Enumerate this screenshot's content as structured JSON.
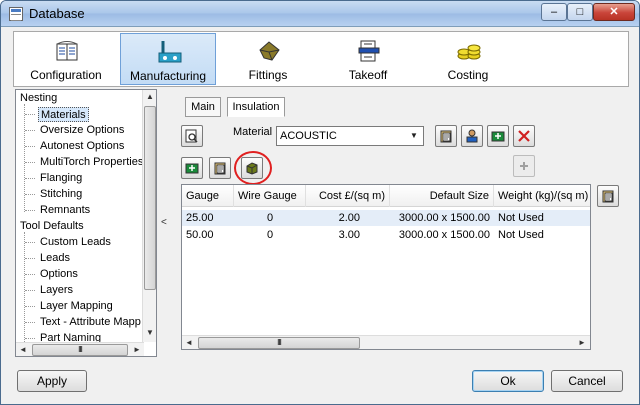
{
  "window": {
    "title": "Database",
    "minimize": "–",
    "maximize": "□",
    "close": "✕"
  },
  "toolbar": [
    {
      "id": "configuration",
      "label": "Configuration",
      "icon": "books-icon"
    },
    {
      "id": "manufacturing",
      "label": "Manufacturing",
      "icon": "manufacturing-icon",
      "active": true
    },
    {
      "id": "fittings",
      "label": "Fittings",
      "icon": "fitting-icon"
    },
    {
      "id": "takeoff",
      "label": "Takeoff",
      "icon": "takeoff-icon"
    },
    {
      "id": "costing",
      "label": "Costing",
      "icon": "coins-icon"
    }
  ],
  "tree": {
    "items": [
      {
        "label": "Nesting",
        "level": 0
      },
      {
        "label": "Materials",
        "level": 1,
        "selected": true
      },
      {
        "label": "Oversize Options",
        "level": 1
      },
      {
        "label": "Autonest Options",
        "level": 1
      },
      {
        "label": "MultiTorch Properties",
        "level": 1
      },
      {
        "label": "Flanging",
        "level": 1
      },
      {
        "label": "Stitching",
        "level": 1
      },
      {
        "label": "Remnants",
        "level": 1
      },
      {
        "label": "Tool Defaults",
        "level": 0
      },
      {
        "label": "Custom Leads",
        "level": 1
      },
      {
        "label": "Leads",
        "level": 1
      },
      {
        "label": "Options",
        "level": 1
      },
      {
        "label": "Layers",
        "level": 1
      },
      {
        "label": "Layer Mapping",
        "level": 1
      },
      {
        "label": "Text - Attribute Mapp",
        "level": 1
      },
      {
        "label": "Part Naming",
        "level": 1
      }
    ],
    "scroll_up": "▲",
    "scroll_down": "▼",
    "scroll_left": "◄",
    "scroll_right": "►",
    "grip": "III"
  },
  "splitter": {
    "arrow": "<"
  },
  "tabs": {
    "main": "Main",
    "insulation": "Insulation"
  },
  "material": {
    "label": "Material",
    "value": "ACOUSTIC",
    "arrow": "▼"
  },
  "grid": {
    "columns": [
      "Gauge",
      "Wire Gauge",
      "Cost £/(sq m)",
      "Default Size",
      "Weight (kg)/(sq m)"
    ],
    "rows": [
      {
        "gauge": "25.00",
        "wire_gauge": "0",
        "cost": "2.00",
        "default_size": "3000.00 x 1500.00",
        "weight": "Not Used"
      },
      {
        "gauge": "50.00",
        "wire_gauge": "0",
        "cost": "3.00",
        "default_size": "3000.00 x 1500.00",
        "weight": "Not Used"
      }
    ],
    "scroll_left": "◄",
    "scroll_right": "►",
    "grip": "III"
  },
  "footer": {
    "apply": "Apply",
    "ok": "Ok",
    "cancel": "Cancel"
  },
  "colors": {
    "accent": "#6fa0d8",
    "highlight_ring": "#e02020",
    "selection": "#d6e8fb"
  }
}
